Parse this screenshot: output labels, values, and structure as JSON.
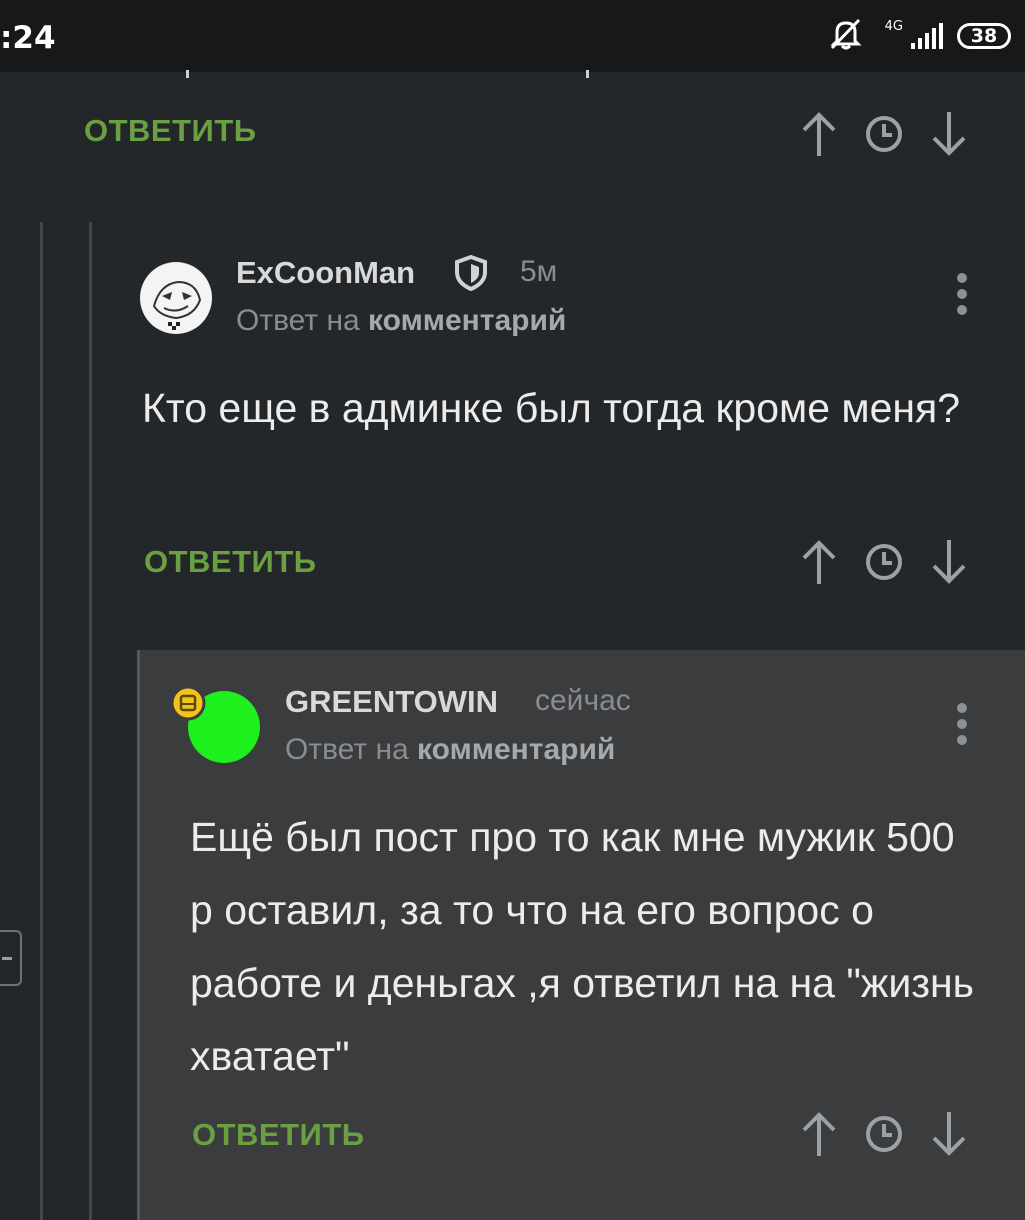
{
  "status_bar": {
    "time": ":24",
    "network": "4G",
    "battery": "38",
    "icons": [
      "mute-icon",
      "signal-icon",
      "battery-icon"
    ]
  },
  "top_comment": {
    "reply_label": "ОТВЕТИТЬ"
  },
  "comments": [
    {
      "username": "ExCoonMan",
      "badge_icon": "shield-icon",
      "time": "5м",
      "reply_prefix": "Ответ на",
      "reply_target": "комментарий",
      "text": "Кто еще в админке был тогда кроме меня?",
      "reply_label": "ОТВЕТИТЬ"
    },
    {
      "username": "GREENTOWIN",
      "time": "сейчас",
      "reply_prefix": "Ответ на",
      "reply_target": "комментарий",
      "text": "Ещё был пост про то как мне мужик 500 р оставил, за то что на его вопрос о работе и деньгах ,я ответил на на \"жизнь хватает\"",
      "reply_label": "ОТВЕТИТЬ",
      "avatar_color": "#1ef01e",
      "badge_color": "#f3c31a"
    }
  ],
  "colors": {
    "background": "#24272a",
    "reply_green": "#6aa041",
    "nested_bg": "#3a3c3e"
  }
}
